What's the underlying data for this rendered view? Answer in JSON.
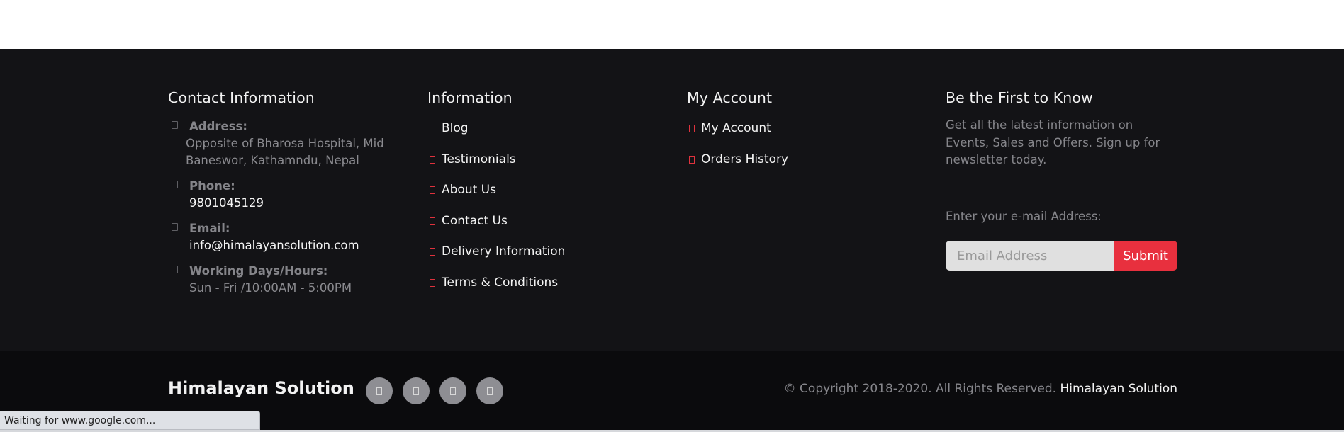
{
  "contact": {
    "heading": "Contact Information",
    "address_label": "Address:",
    "address_line1": "Opposite of Bharosa Hospital, Mid",
    "address_line2": "Baneswor, Kathamndu, Nepal",
    "phone_label": "Phone:",
    "phone": "9801045129",
    "email_label": "Email:",
    "email": "info@himalayansolution.com",
    "hours_label": "Working Days/Hours:",
    "hours": "Sun - Fri /10:00AM - 5:00PM"
  },
  "information": {
    "heading": "Information",
    "links": [
      "Blog",
      "Testimonials",
      "About Us",
      "Contact Us",
      "Delivery Information",
      "Terms & Conditions"
    ]
  },
  "account": {
    "heading": "My Account",
    "links": [
      "My Account",
      "Orders History"
    ]
  },
  "newsletter": {
    "heading": "Be the First to Know",
    "description": "Get all the latest information on Events, Sales and Offers. Sign up for newsletter today.",
    "email_label": "Enter your e-mail Address:",
    "email_placeholder": "Email Address",
    "submit_label": "Submit"
  },
  "bottom": {
    "brand": "Himalayan Solution",
    "social_icons": [
      "facebook-icon",
      "twitter-icon",
      "instagram-icon",
      "linkedin-icon"
    ],
    "copyright": "© Copyright 2018-2020. All Rights Reserved.",
    "copyright_link": "Himalayan Solution"
  },
  "status_bar": "Waiting for www.google.com...",
  "colors": {
    "accent": "#e8303e",
    "footer_bg": "#131316",
    "bottom_bg": "#0b0b0d"
  }
}
